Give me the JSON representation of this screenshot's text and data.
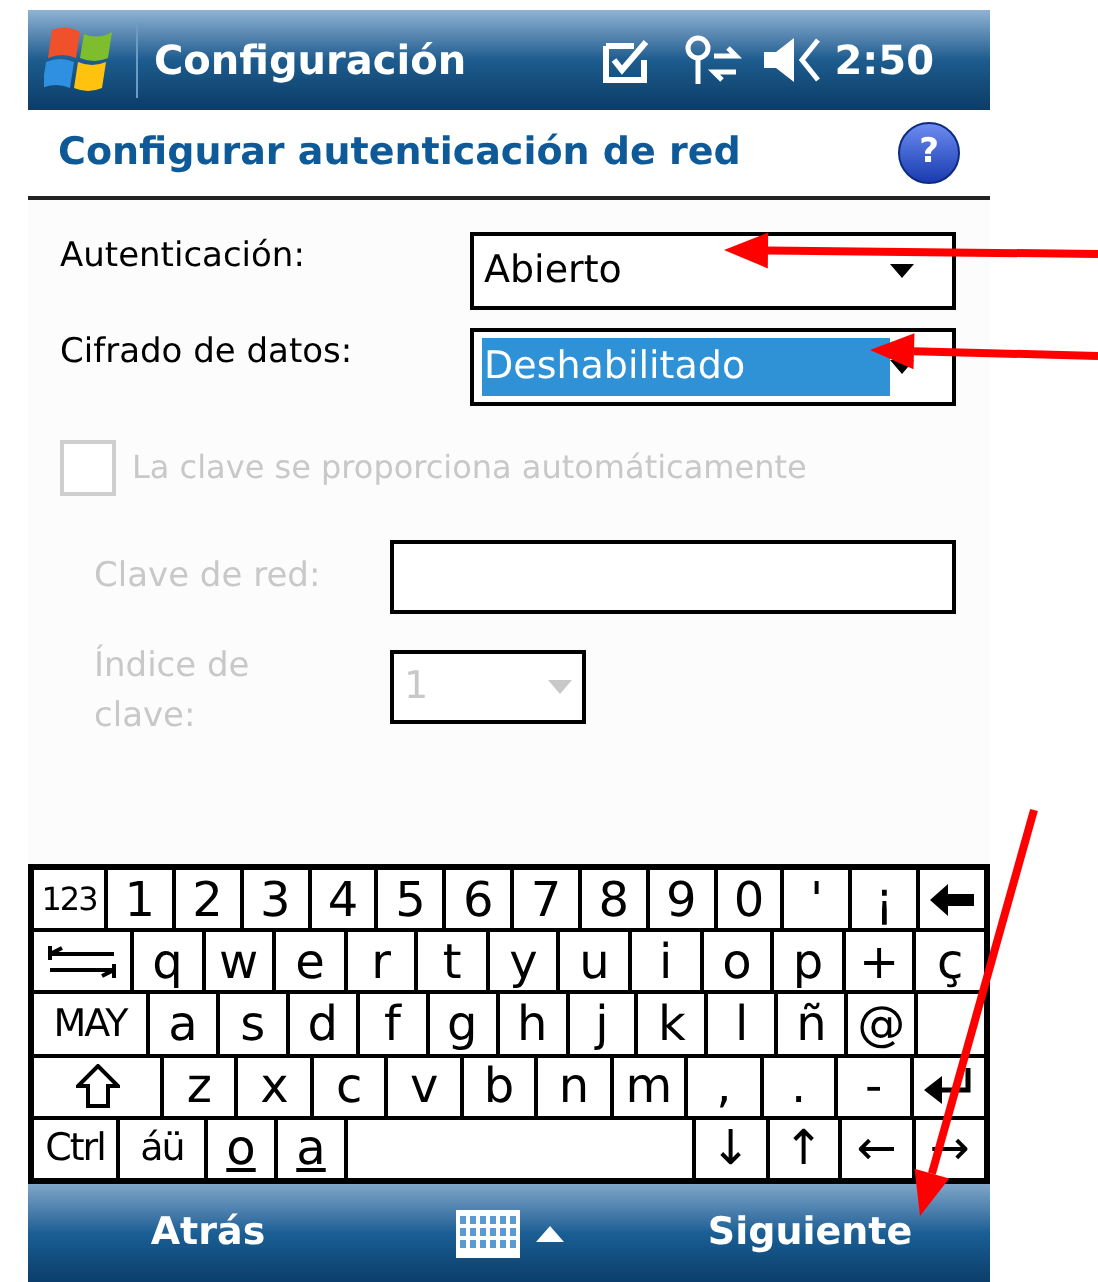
{
  "title_bar": {
    "title": "Configuración",
    "time": "2:50"
  },
  "header": {
    "title": "Configurar autenticación de red",
    "help": "?"
  },
  "form": {
    "authentication": {
      "label": "Autenticación:",
      "value": "Abierto",
      "selected": false
    },
    "encryption": {
      "label": "Cifrado de datos:",
      "value": "Deshabilitado",
      "selected": true
    },
    "auto_key": {
      "label": "La clave se proporciona automáticamente",
      "checked": false,
      "disabled": true
    },
    "network_key": {
      "label": "Clave de red:",
      "disabled": true
    },
    "key_index": {
      "label": "Índice de clave:",
      "value": "1",
      "disabled": true
    }
  },
  "keyboard": {
    "key_rows": [
      [
        {
          "kind": "num",
          "text": "123"
        },
        {
          "kind": "char",
          "text": "1"
        },
        {
          "kind": "char",
          "text": "2"
        },
        {
          "kind": "char",
          "text": "3"
        },
        {
          "kind": "char",
          "text": "4"
        },
        {
          "kind": "char",
          "text": "5"
        },
        {
          "kind": "char",
          "text": "6"
        },
        {
          "kind": "char",
          "text": "7"
        },
        {
          "kind": "char",
          "text": "8"
        },
        {
          "kind": "char",
          "text": "9"
        },
        {
          "kind": "char",
          "text": "0"
        },
        {
          "kind": "char",
          "text": "'"
        },
        {
          "kind": "char",
          "text": "¡"
        },
        {
          "kind": "backspace"
        }
      ],
      [
        {
          "kind": "tab"
        },
        {
          "kind": "char",
          "text": "q"
        },
        {
          "kind": "char",
          "text": "w"
        },
        {
          "kind": "char",
          "text": "e"
        },
        {
          "kind": "char",
          "text": "r"
        },
        {
          "kind": "char",
          "text": "t"
        },
        {
          "kind": "char",
          "text": "y"
        },
        {
          "kind": "char",
          "text": "u"
        },
        {
          "kind": "char",
          "text": "i"
        },
        {
          "kind": "char",
          "text": "o"
        },
        {
          "kind": "char",
          "text": "p"
        },
        {
          "kind": "char",
          "text": "+"
        },
        {
          "kind": "char",
          "text": "ç"
        }
      ],
      [
        {
          "kind": "caps",
          "text": "MAY"
        },
        {
          "kind": "char",
          "text": "a"
        },
        {
          "kind": "char",
          "text": "s"
        },
        {
          "kind": "char",
          "text": "d"
        },
        {
          "kind": "char",
          "text": "f"
        },
        {
          "kind": "char",
          "text": "g"
        },
        {
          "kind": "char",
          "text": "h"
        },
        {
          "kind": "char",
          "text": "j"
        },
        {
          "kind": "char",
          "text": "k"
        },
        {
          "kind": "char",
          "text": "l"
        },
        {
          "kind": "char",
          "text": "ñ"
        },
        {
          "kind": "char",
          "text": "@"
        },
        {
          "kind": "blank"
        }
      ],
      [
        {
          "kind": "shift"
        },
        {
          "kind": "char",
          "text": "z"
        },
        {
          "kind": "char",
          "text": "x"
        },
        {
          "kind": "char",
          "text": "c"
        },
        {
          "kind": "char",
          "text": "v"
        },
        {
          "kind": "char",
          "text": "b"
        },
        {
          "kind": "char",
          "text": "n"
        },
        {
          "kind": "char",
          "text": "m"
        },
        {
          "kind": "char",
          "text": ","
        },
        {
          "kind": "char",
          "text": "."
        },
        {
          "kind": "char",
          "text": "-"
        },
        {
          "kind": "enter"
        }
      ],
      [
        {
          "kind": "ctrl",
          "text": "Ctrl"
        },
        {
          "kind": "accent",
          "text": "áü"
        },
        {
          "kind": "ordinal",
          "text": "o"
        },
        {
          "kind": "ordinal",
          "text": "a"
        },
        {
          "kind": "space"
        },
        {
          "kind": "char",
          "text": "↓"
        },
        {
          "kind": "char",
          "text": "↑"
        },
        {
          "kind": "char",
          "text": "←"
        },
        {
          "kind": "char",
          "text": "→"
        }
      ]
    ]
  },
  "menu_bar": {
    "left": "Atrás",
    "right": "Siguiente"
  }
}
